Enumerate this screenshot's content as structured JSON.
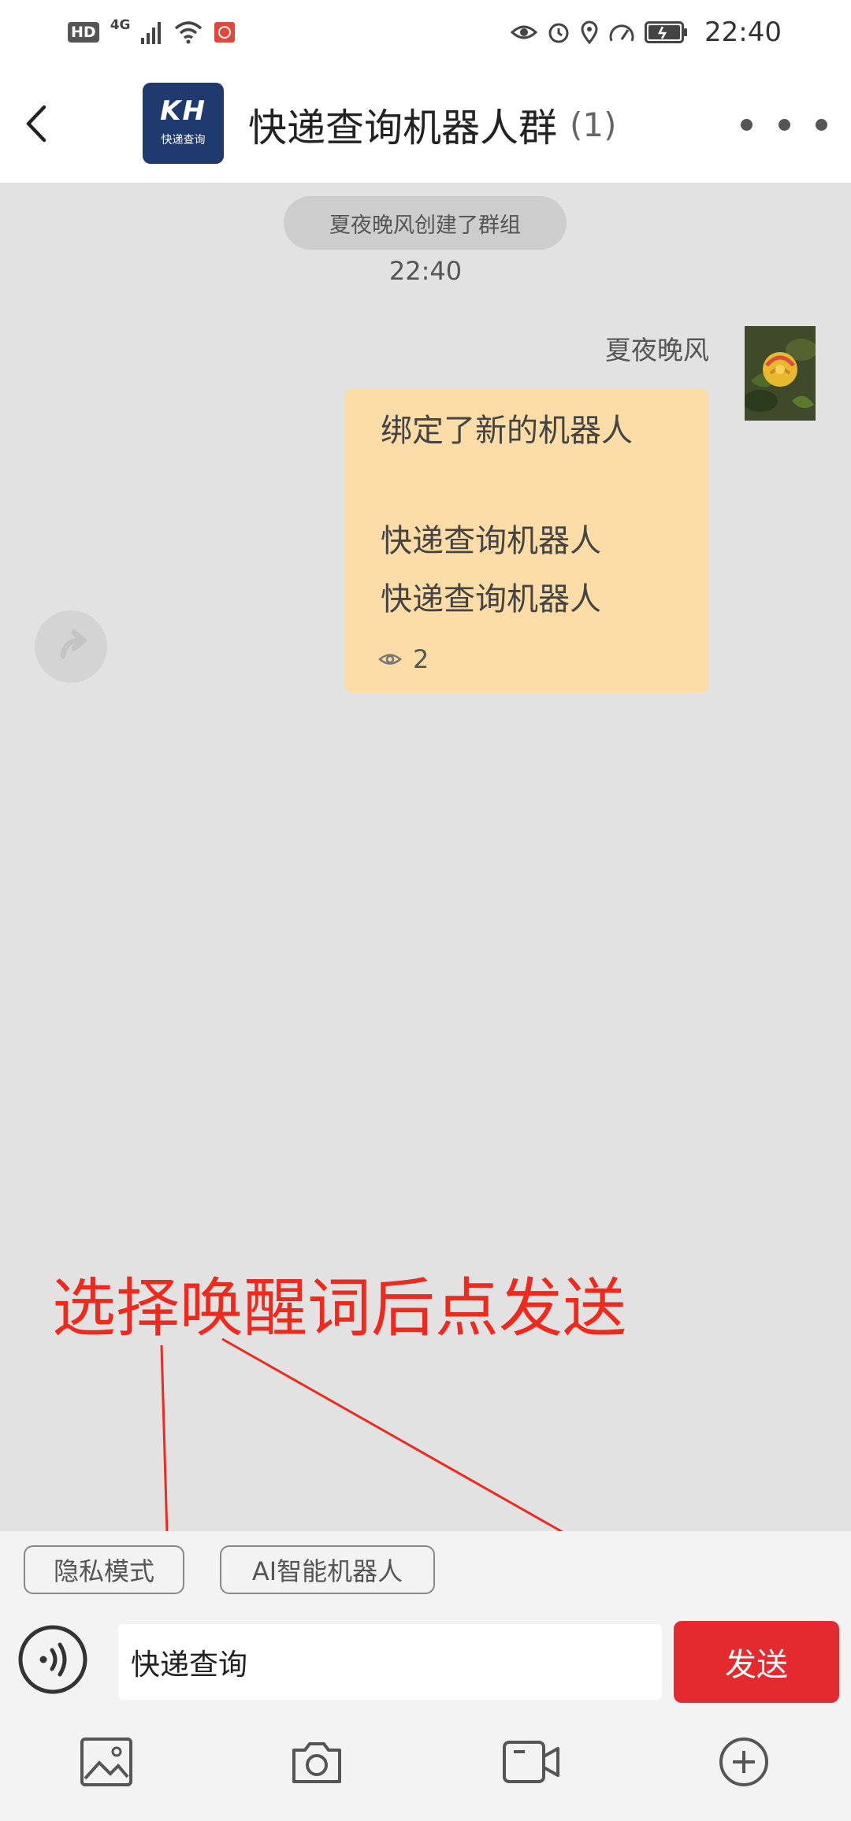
{
  "status_bar": {
    "hd_badge": "HD",
    "network_label": "4G",
    "time": "22:40"
  },
  "header": {
    "back_icon": "chevron-left-icon",
    "logo_mark": "KH",
    "logo_subtitle": "快递查询",
    "title": "快递查询机器人群",
    "member_count": "(1)"
  },
  "chat": {
    "system_notice": "夏夜晚风创建了群组",
    "notice_time": "22:40",
    "message": {
      "sender": "夏夜晚风",
      "line1": "绑定了新的机器人",
      "line2": "快递查询机器人",
      "line3": "快递查询机器人",
      "views": "2"
    }
  },
  "annotation": {
    "text": "选择唤醒词后点发送",
    "color": "#ee2a1e"
  },
  "composer": {
    "chips": {
      "privacy": "隐私模式",
      "ai_robot": "AI智能机器人"
    },
    "input_value": "快递查询",
    "send_label": "发送",
    "send_color": "#e32a2e"
  },
  "toolbar_icons": [
    "image-icon",
    "camera-icon",
    "video-icon",
    "plus-circle-icon"
  ]
}
